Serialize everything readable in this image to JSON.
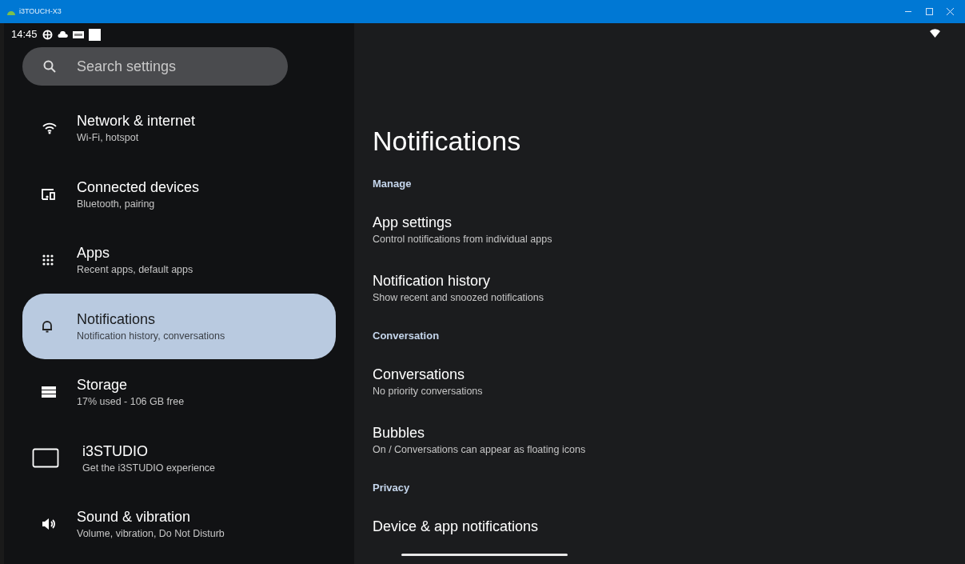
{
  "window": {
    "title": "i3TOUCH-X3"
  },
  "status_bar": {
    "time": "14:45"
  },
  "search": {
    "placeholder": "Search settings"
  },
  "sidebar": {
    "items": [
      {
        "title": "Network & internet",
        "subtitle": "Wi-Fi, hotspot",
        "selected": false
      },
      {
        "title": "Connected devices",
        "subtitle": "Bluetooth, pairing",
        "selected": false
      },
      {
        "title": "Apps",
        "subtitle": "Recent apps, default apps",
        "selected": false
      },
      {
        "title": "Notifications",
        "subtitle": "Notification history, conversations",
        "selected": true
      },
      {
        "title": "Storage",
        "subtitle": "17% used - 106 GB free",
        "selected": false
      },
      {
        "title": "i3STUDIO",
        "subtitle": "Get the i3STUDIO experience",
        "selected": false
      },
      {
        "title": "Sound & vibration",
        "subtitle": "Volume, vibration, Do Not Disturb",
        "selected": false
      }
    ]
  },
  "page": {
    "title": "Notifications",
    "sections": [
      {
        "heading": "Manage",
        "items": [
          {
            "title": "App settings",
            "subtitle": "Control notifications from individual apps"
          },
          {
            "title": "Notification history",
            "subtitle": "Show recent and snoozed notifications"
          }
        ]
      },
      {
        "heading": "Conversation",
        "items": [
          {
            "title": "Conversations",
            "subtitle": "No priority conversations"
          },
          {
            "title": "Bubbles",
            "subtitle": "On / Conversations can appear as floating icons"
          }
        ]
      },
      {
        "heading": "Privacy",
        "items": [
          {
            "title": "Device & app notifications"
          }
        ]
      }
    ]
  }
}
